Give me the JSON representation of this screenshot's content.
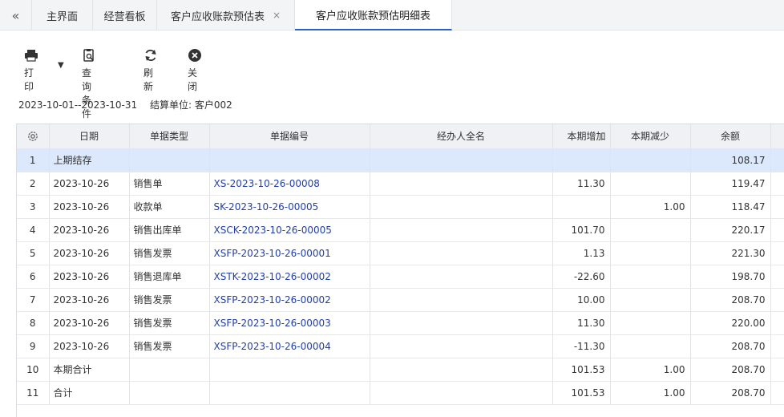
{
  "tabs": {
    "collapse_icon": "double-chevron-left-icon",
    "items": [
      {
        "label": "主界面"
      },
      {
        "label": "经营看板"
      },
      {
        "label": "客户应收账款预估表",
        "closable": true
      },
      {
        "label": "客户应收账款预估明细表",
        "active": true
      }
    ],
    "close_glyph": "×"
  },
  "toolbar": {
    "print": "打印",
    "query": "查询条件",
    "refresh": "刷新",
    "close": "关闭"
  },
  "filter": {
    "period": "2023-10-01--2023-10-31",
    "unit": "结算单位: 客户002"
  },
  "grid": {
    "headers": [
      "日期",
      "单据类型",
      "单据编号",
      "经办人全名",
      "本期增加",
      "本期减少",
      "余额"
    ],
    "rows": [
      {
        "idx": "1",
        "date": "上期结存",
        "type": "",
        "no": "",
        "handler": "",
        "inc": "",
        "dec": "",
        "bal": "108.17"
      },
      {
        "idx": "2",
        "date": "2023-10-26",
        "type": "销售单",
        "no": "XS-2023-10-26-00008",
        "handler": "",
        "inc": "11.30",
        "dec": "",
        "bal": "119.47"
      },
      {
        "idx": "3",
        "date": "2023-10-26",
        "type": "收款单",
        "no": "SK-2023-10-26-00005",
        "handler": "",
        "inc": "",
        "dec": "1.00",
        "bal": "118.47"
      },
      {
        "idx": "4",
        "date": "2023-10-26",
        "type": "销售出库单",
        "no": "XSCK-2023-10-26-00005",
        "handler": "",
        "inc": "101.70",
        "dec": "",
        "bal": "220.17"
      },
      {
        "idx": "5",
        "date": "2023-10-26",
        "type": "销售发票",
        "no": "XSFP-2023-10-26-00001",
        "handler": "",
        "inc": "1.13",
        "dec": "",
        "bal": "221.30"
      },
      {
        "idx": "6",
        "date": "2023-10-26",
        "type": "销售退库单",
        "no": "XSTK-2023-10-26-00002",
        "handler": "",
        "inc": "-22.60",
        "dec": "",
        "bal": "198.70"
      },
      {
        "idx": "7",
        "date": "2023-10-26",
        "type": "销售发票",
        "no": "XSFP-2023-10-26-00002",
        "handler": "",
        "inc": "10.00",
        "dec": "",
        "bal": "208.70"
      },
      {
        "idx": "8",
        "date": "2023-10-26",
        "type": "销售发票",
        "no": "XSFP-2023-10-26-00003",
        "handler": "",
        "inc": "11.30",
        "dec": "",
        "bal": "220.00"
      },
      {
        "idx": "9",
        "date": "2023-10-26",
        "type": "销售发票",
        "no": "XSFP-2023-10-26-00004",
        "handler": "",
        "inc": "-11.30",
        "dec": "",
        "bal": "208.70"
      },
      {
        "idx": "10",
        "date": "本期合计",
        "type": "",
        "no": "",
        "handler": "",
        "inc": "101.53",
        "dec": "1.00",
        "bal": "208.70"
      },
      {
        "idx": "11",
        "date": "合计",
        "type": "",
        "no": "",
        "handler": "",
        "inc": "101.53",
        "dec": "1.00",
        "bal": "208.70"
      }
    ]
  },
  "colors": {
    "accent": "#2b5fc7",
    "link": "#1f3fa8",
    "highlight_row": "#dce8fb"
  }
}
